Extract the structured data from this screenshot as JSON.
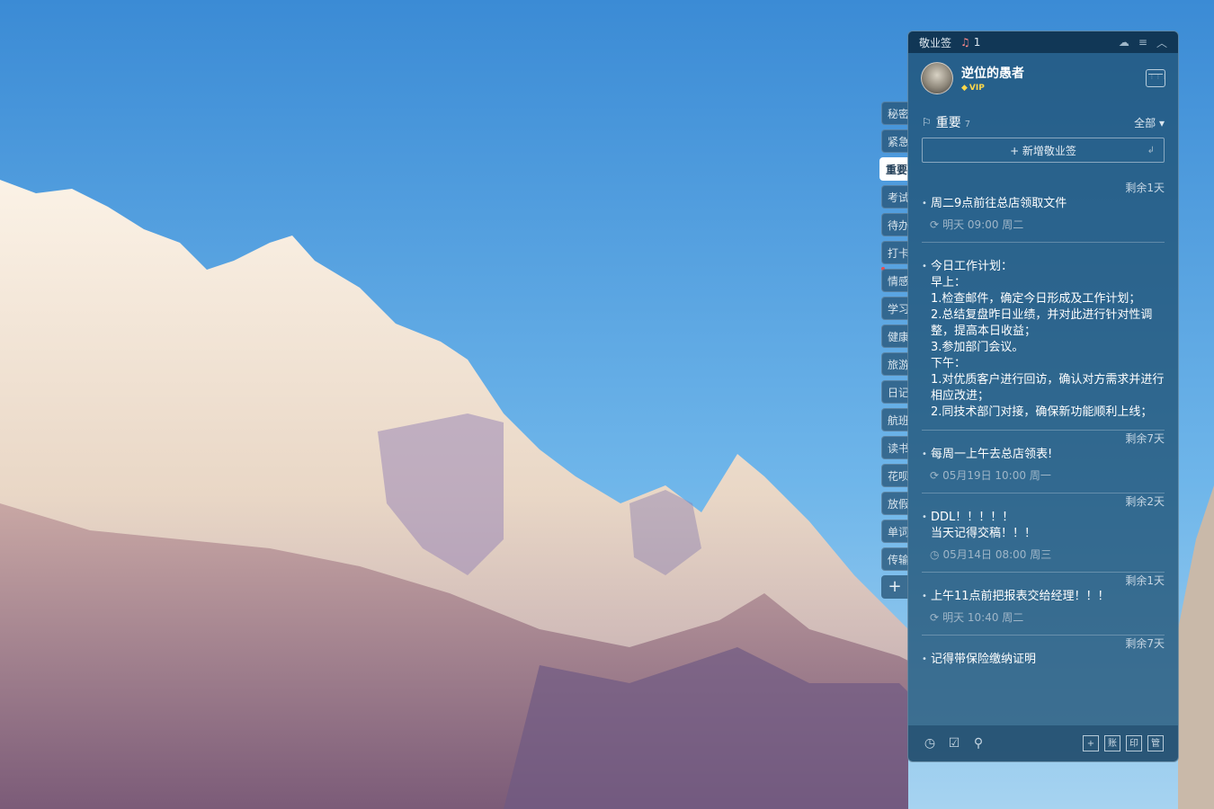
{
  "side_tabs": [
    "秘密",
    "紧急",
    "重要",
    "考试",
    "待办",
    "打卡",
    "情感",
    "学习",
    "健康",
    "旅游",
    "日记",
    "航班",
    "读书",
    "花呗",
    "放假",
    "单词",
    "传输"
  ],
  "side_tabs_active": "重要",
  "side_add_label": "+",
  "panel": {
    "app_name": "敬业签",
    "notification_count": "1",
    "user": {
      "name": "逆位的愚者",
      "badge": "VIP"
    },
    "section": {
      "title": "重要",
      "count": "7",
      "filter": "全部"
    },
    "new_button_label": "+ 新增敬业签",
    "notes": [
      {
        "remain": "剩余1天",
        "text": "周二9点前往总店领取文件",
        "meta": "明天 09:00 周二",
        "meta_icon": "repeat-icon"
      },
      {
        "remain": "",
        "text": "今日工作计划：\n早上：\n1.检查邮件，确定今日形成及工作计划；\n2.总结复盘昨日业绩，并对此进行针对性调整，提高本日收益；\n3.参加部门会议。\n下午：\n1.对优质客户进行回访，确认对方需求并进行相应改进；\n2.同技术部门对接，确保新功能顺利上线；",
        "meta": "",
        "meta_icon": ""
      },
      {
        "remain": "剩余7天",
        "text": "每周一上午去总店领表!",
        "meta": "05月19日 10:00 周一",
        "meta_icon": "repeat-icon"
      },
      {
        "remain": "剩余2天",
        "text": "DDL！！！！！\n当天记得交稿！！！",
        "meta": "05月14日 08:00 周三",
        "meta_icon": "clock-icon"
      },
      {
        "remain": "剩余1天",
        "text": "上午11点前把报表交给经理！！！",
        "meta": "明天 10:40 周二",
        "meta_icon": "repeat-icon"
      },
      {
        "remain": "剩余7天",
        "text": "记得带保险缴纳证明",
        "meta": "",
        "meta_icon": ""
      }
    ]
  },
  "colors": {
    "panel_bg": "#1d4e70",
    "accent_vip": "#ffd84a"
  }
}
